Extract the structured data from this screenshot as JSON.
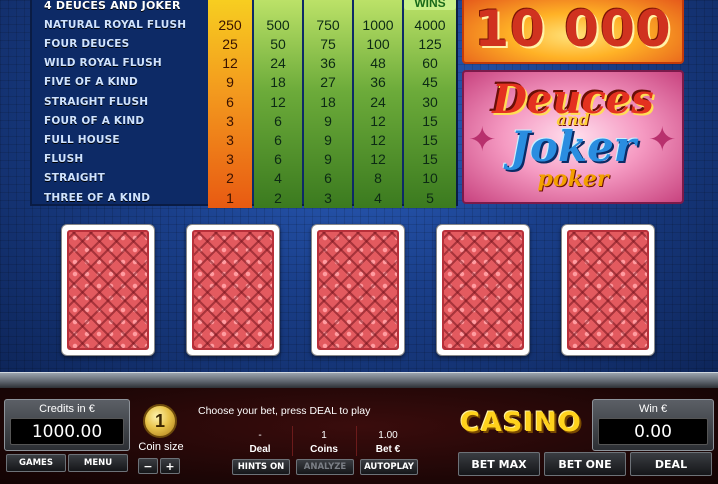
{
  "paytable": {
    "title": "4 DEUCES AND JOKER",
    "wins_label": "WINS",
    "rows": [
      {
        "name": "NATURAL ROYAL FLUSH",
        "pays": [
          "250",
          "500",
          "750",
          "1000",
          "4000"
        ]
      },
      {
        "name": "FOUR DEUCES",
        "pays": [
          "25",
          "50",
          "75",
          "100",
          "125"
        ]
      },
      {
        "name": "WILD ROYAL FLUSH",
        "pays": [
          "12",
          "24",
          "36",
          "48",
          "60"
        ]
      },
      {
        "name": "FIVE OF A KIND",
        "pays": [
          "9",
          "18",
          "27",
          "36",
          "45"
        ]
      },
      {
        "name": "STRAIGHT FLUSH",
        "pays": [
          "6",
          "12",
          "18",
          "24",
          "30"
        ]
      },
      {
        "name": "FOUR OF A KIND",
        "pays": [
          "3",
          "6",
          "9",
          "12",
          "15"
        ]
      },
      {
        "name": "FULL HOUSE",
        "pays": [
          "3",
          "6",
          "9",
          "12",
          "15"
        ]
      },
      {
        "name": "FLUSH",
        "pays": [
          "3",
          "6",
          "9",
          "12",
          "15"
        ]
      },
      {
        "name": "STRAIGHT",
        "pays": [
          "2",
          "4",
          "6",
          "8",
          "10"
        ]
      },
      {
        "name": "THREE OF A KIND",
        "pays": [
          "1",
          "2",
          "3",
          "4",
          "5"
        ]
      }
    ]
  },
  "jackpot": {
    "value": "10 000"
  },
  "logo": {
    "line1": "Deuces",
    "line2": "and",
    "line3": "Joker",
    "line4": "poker"
  },
  "cards": [
    {
      "state": "face-down"
    },
    {
      "state": "face-down"
    },
    {
      "state": "face-down"
    },
    {
      "state": "face-down"
    },
    {
      "state": "face-down"
    }
  ],
  "controls": {
    "credits_label": "Credits in €",
    "credits_value": "1000.00",
    "games_btn": "GAMES",
    "menu_btn": "MENU",
    "coin_value": "1",
    "coin_size_label": "Coin size",
    "minus": "−",
    "plus": "+",
    "status_message": "Choose your bet, press DEAL to play",
    "deal_value": "-",
    "deal_label": "Deal",
    "coins_value": "1",
    "coins_label": "Coins",
    "bet_value": "1.00",
    "bet_label": "Bet €",
    "hints_btn": "HINTS ON",
    "analyze_btn": "ANALYZE",
    "autoplay_btn": "AUTOPLAY",
    "casino_logo": "CASINO",
    "win_label": "Win €",
    "win_value": "0.00",
    "bet_max_btn": "BET MAX",
    "bet_one_btn": "BET ONE",
    "deal_btn": "DEAL"
  },
  "colors": {
    "paytable_active_column": "#f39a1e",
    "paytable_columns": "#6cab3a",
    "accent_gold": "#ffd21c",
    "background_blue": "#1a3f8a"
  }
}
